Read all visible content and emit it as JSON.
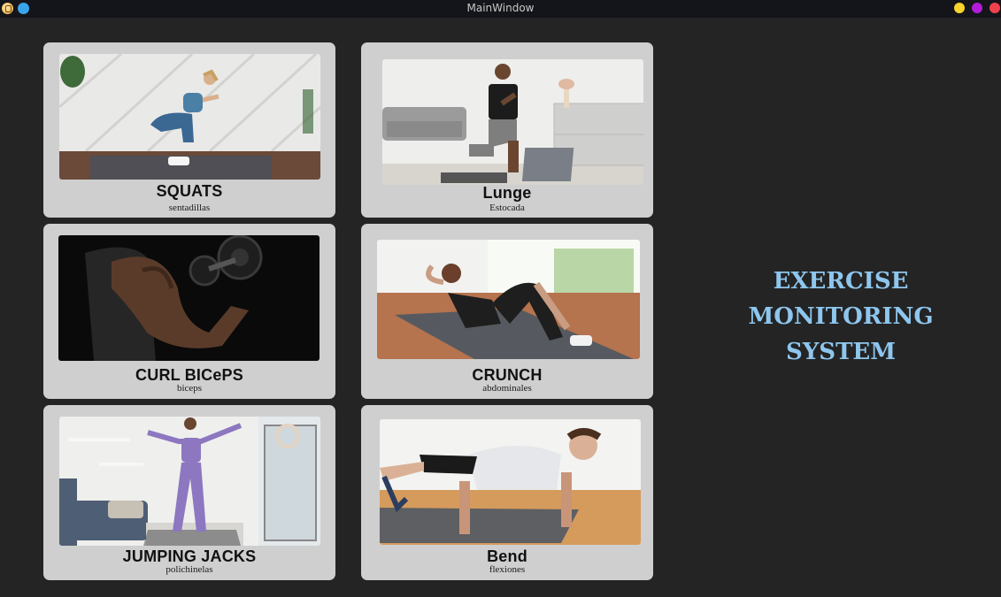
{
  "window": {
    "title": "MainWindow"
  },
  "headline": {
    "line1": "EXERCISE",
    "line2": "MONITORING",
    "line3": "SYSTEM"
  },
  "exercises": [
    {
      "name": "SQUATS",
      "subtitle": "sentadillas"
    },
    {
      "name": "Lunge",
      "subtitle": "Estocada"
    },
    {
      "name": "CURL BICePS",
      "subtitle": "biceps"
    },
    {
      "name": "CRUNCH",
      "subtitle": "abdominales"
    },
    {
      "name": "JUMPING JACKS",
      "subtitle": "polichinelas"
    },
    {
      "name": "Bend",
      "subtitle": "flexiones"
    }
  ],
  "colors": {
    "background": "#242424",
    "card": "#cfcfcf",
    "headline": "#8ec6ee",
    "titlebar": "#14151a"
  }
}
